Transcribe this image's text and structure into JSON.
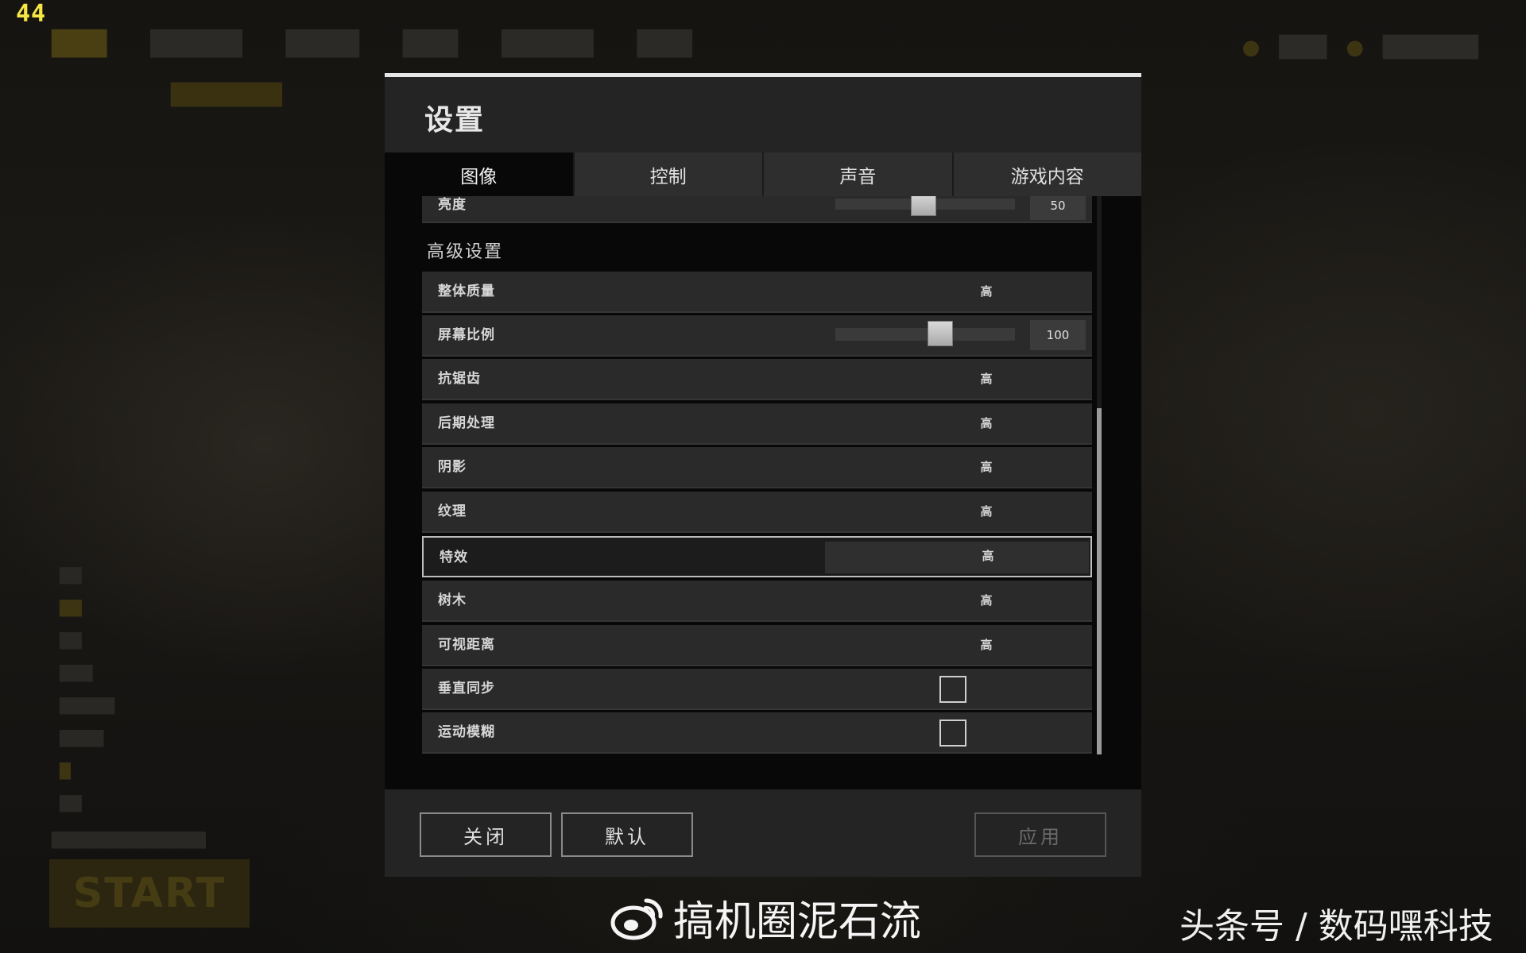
{
  "hud": {
    "fps": "44"
  },
  "background": {
    "nav_items": [
      "",
      "",
      "",
      "",
      "",
      ""
    ],
    "top_right": [
      "",
      ""
    ],
    "start_label": "START"
  },
  "modal": {
    "title": "设置",
    "tabs": [
      {
        "label": "图像",
        "active": true
      },
      {
        "label": "控制",
        "active": false
      },
      {
        "label": "声音",
        "active": false
      },
      {
        "label": "游戏内容",
        "active": false
      }
    ],
    "brightness": {
      "label": "亮度",
      "value": "50",
      "level": 50
    },
    "advanced_heading": "高级设置",
    "rows": [
      {
        "label": "整体质量",
        "value": "高"
      },
      {
        "label": "屏幕比例",
        "value": "100",
        "level": 100
      },
      {
        "label": "抗锯齿",
        "value": "高"
      },
      {
        "label": "后期处理",
        "value": "高"
      },
      {
        "label": "阴影",
        "value": "高"
      },
      {
        "label": "纹理",
        "value": "高"
      },
      {
        "label": "特效",
        "value": "高"
      },
      {
        "label": "树木",
        "value": "高"
      },
      {
        "label": "可视距离",
        "value": "高"
      },
      {
        "label": "垂直同步",
        "checked": false
      },
      {
        "label": "运动模糊",
        "checked": false
      }
    ],
    "buttons": {
      "close": "关闭",
      "default": "默认",
      "apply": "应用"
    }
  },
  "watermarks": {
    "center": "搞机圈泥石流",
    "right": "头条号 / 数码嘿科技"
  }
}
